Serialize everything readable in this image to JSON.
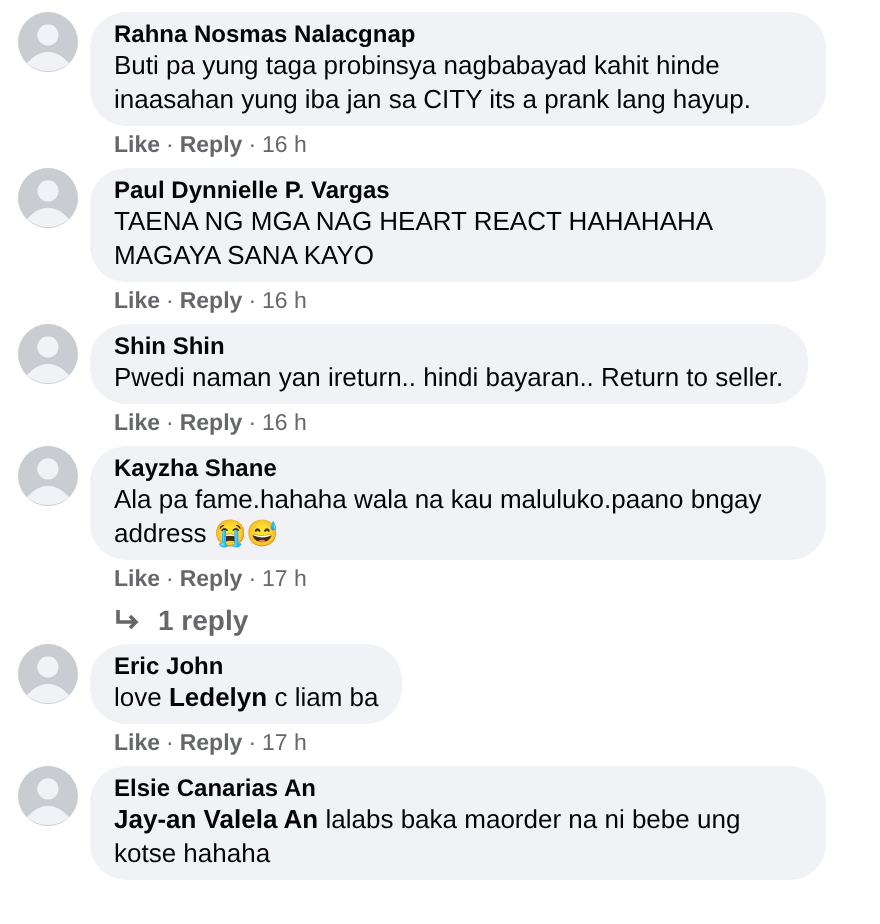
{
  "separator": "·",
  "comments": [
    {
      "author": "Rahna Nosmas Nalacgnap",
      "text": "Buti pa yung taga probinsya nagbabayad kahit hinde inaasahan yung iba jan sa CITY its a prank lang hayup.",
      "like": "Like",
      "reply": "Reply",
      "time": "16 h"
    },
    {
      "author": "Paul Dynnielle P. Vargas",
      "text": "TAENA NG MGA NAG HEART REACT HAHAHAHA MAGAYA SANA KAYO",
      "like": "Like",
      "reply": "Reply",
      "time": "16 h"
    },
    {
      "author": "Shin Shin",
      "text": "Pwedi naman yan ireturn.. hindi bayaran.. Return to seller.",
      "like": "Like",
      "reply": "Reply",
      "time": "16 h"
    },
    {
      "author": "Kayzha Shane",
      "text": "Ala pa fame.hahaha wala na kau maluluko.paano bngay address 😭😅",
      "like": "Like",
      "reply": "Reply",
      "time": "17 h",
      "replies": "1 reply"
    },
    {
      "author": "Eric John",
      "text": "love **Ledelyn** c liam ba",
      "like": "Like",
      "reply": "Reply",
      "time": "17 h"
    },
    {
      "author": "Elsie Canarias An",
      "text": "**Jay-an Valela An** lalabs baka maorder na ni bebe ung kotse hahaha"
    }
  ]
}
